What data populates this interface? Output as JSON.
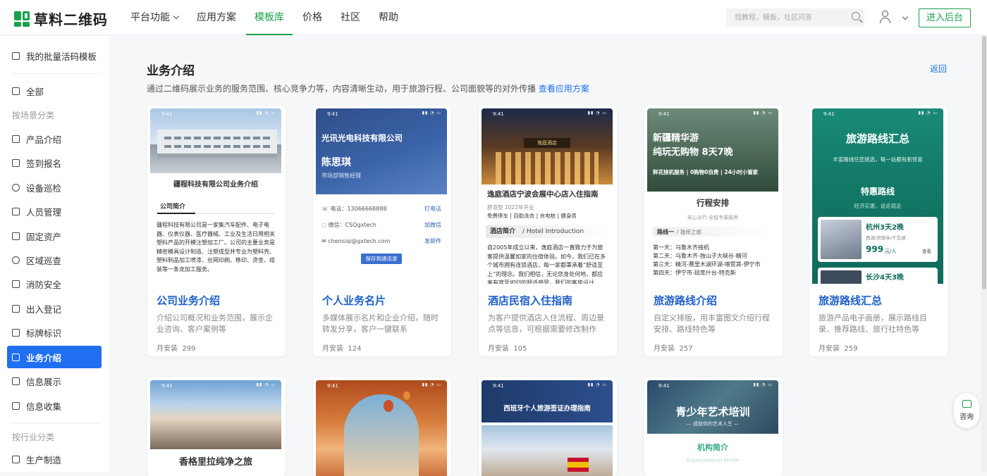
{
  "brand": {
    "name": "草料二维码"
  },
  "nav": [
    {
      "label": "平台功能"
    },
    {
      "label": "应用方案"
    },
    {
      "label": "模板库"
    },
    {
      "label": "价格"
    },
    {
      "label": "社区"
    },
    {
      "label": "帮助"
    }
  ],
  "search": {
    "placeholder": "找教程，模板，社区问答"
  },
  "enter_btn": "进入后台",
  "sidebar": {
    "top": "我的批量活码模板",
    "all": "全部",
    "cat_scene": "按场景分类",
    "items": [
      "产品介绍",
      "签到报名",
      "设备巡检",
      "人员管理",
      "固定资产",
      "区域巡查",
      "消防安全",
      "出入登记",
      "标牌标识",
      "业务介绍",
      "信息展示",
      "信息收集"
    ],
    "cat_industry": "按行业分类",
    "ind_items": [
      "生产制造"
    ]
  },
  "page": {
    "title": "业务介绍",
    "back": "返回",
    "desc": "通过二维码展示业务的服务范围、核心竞争力等，内容清晰生动，用于旅游行程、公司面貌等的对外传播",
    "desc_link": "查看应用方案"
  },
  "cards": [
    {
      "title": "公司业务介绍",
      "desc": "介绍公司概况和业务范围，展示企业咨询、客户案例等",
      "installs_label": "月安装",
      "installs": "299",
      "preview": {
        "time": "9:41",
        "heading": "疆程科技有限公司业务介绍",
        "section": "公司简介",
        "body": "疆程科技有限公司是一家集汽车配件、电子电器、仪表仪器、医疗器械、工业及生活日用相关塑料产品的开模注塑加工厂。公司的主要业务是精密模具设计制造、注塑成型并专业为塑料壳、塑料制品加工喷漆、丝网印刷、移印、烫金、组装等一条龙加工服务。"
      }
    },
    {
      "title": "个人业务名片",
      "desc": "多媒体展示名片和企业介绍，随时转发分享，客户一键联系",
      "installs_label": "月安装",
      "installs": "124",
      "preview": {
        "time": "9:41",
        "company": "光讯光电科技有限公司",
        "name": "陈思琪",
        "role": "市场部销售经理",
        "rows": [
          {
            "label": "电话：13066668888",
            "action": "打电话"
          },
          {
            "label": "微信：CSQgxtech",
            "action": "加微信"
          },
          {
            "label": "chensiqi@gxtech.com",
            "action": "发邮件"
          }
        ],
        "button": "保存到通讯录"
      }
    },
    {
      "title": "酒店民宿入住指南",
      "desc": "为客户提供酒店入住流程、周边景点等信息，可根据需要修改制作",
      "installs_label": "月安装",
      "installs": "105",
      "preview": {
        "time": "9:41",
        "sign": "逸庭酒店",
        "heading": "逸庭酒店宁波会展中心店入住指南",
        "sub": "舒适型  2022年开业",
        "tags": "免费停车 | 自助洗衣 | 充电桩 | 健身房",
        "section": "酒店简介",
        "section_en": "/ Hotel Introduction",
        "body": "自2005年成立以来，逸庭酒店一直致力于为旅客提供温馨如家的住宿体验。如今，我们已在多个城市拥有连锁酒店，每一家都秉承着“舒适至上”的理念。我们相信，无论您身处何地，都应享有宾至如归的舒适感受。我们的客房设计"
      }
    },
    {
      "title": "旅游路线介绍",
      "desc": "自定义排版，用丰富图文介绍行程安排、路线特色等",
      "installs_label": "月安装",
      "installs": "257",
      "preview": {
        "time": "9:41",
        "heading1": "新疆精华游",
        "heading2": "纯玩无购物 8天7晚",
        "tagline": "鲜花接机服务 | 0购物0自费 | 24小时小管家",
        "section": "行程安排",
        "sub": "安心出行 全程专属服务",
        "route": "路线一",
        "route_sub": "/ 独库之旅",
        "days": [
          "第一天：乌鲁木齐接机",
          "第二天：乌鲁木齐-独山子大峡谷-精河",
          "第三天：精河-赛里木湖环湖-喀赞其-伊宁市",
          "第四天：伊宁市-琼库什台-特克斯"
        ]
      }
    },
    {
      "title": "旅游路线汇总",
      "desc": "旅游产品电子画册，展示路线目录、推荐路线、旅行社特色等",
      "installs_label": "月安装",
      "installs": "259",
      "preview": {
        "time": "9:41",
        "heading": "旅游路线汇总",
        "sub": "丰富路线任您挑选，每一站都有新惊喜",
        "section": "特惠路线",
        "section_sub": "经济实惠、说走就走",
        "item1": "杭州3天2晚",
        "item1_sub": "西湖/灵隐寺/千岛湖",
        "price": "999",
        "price_unit": "元/人",
        "view": "查看",
        "item2": "长沙4天3晚"
      }
    },
    {
      "title": "",
      "desc": "",
      "installs_label": "",
      "installs": "",
      "preview": {
        "time": "9:41",
        "heading": "香格里拉纯净之旅"
      }
    },
    {
      "title": "",
      "desc": "",
      "installs_label": "",
      "installs": "",
      "preview": {
        "time": "9:41"
      }
    },
    {
      "title": "",
      "desc": "",
      "installs_label": "",
      "installs": "",
      "preview": {
        "time": "9:41",
        "heading": "西班牙个人旅游签证办理指南"
      }
    },
    {
      "title": "",
      "desc": "",
      "installs_label": "",
      "installs": "",
      "preview": {
        "time": "9:41",
        "heading": "青少年艺术培训",
        "sub": "— 成就你的艺术人生 —",
        "section": "机构简介",
        "section_en": "Organizational Profile"
      }
    }
  ],
  "consult": "咨询",
  "colors": {
    "brand": "#1aa04a",
    "accent": "#1f6ff0",
    "title_blue": "#1f5fc9"
  }
}
